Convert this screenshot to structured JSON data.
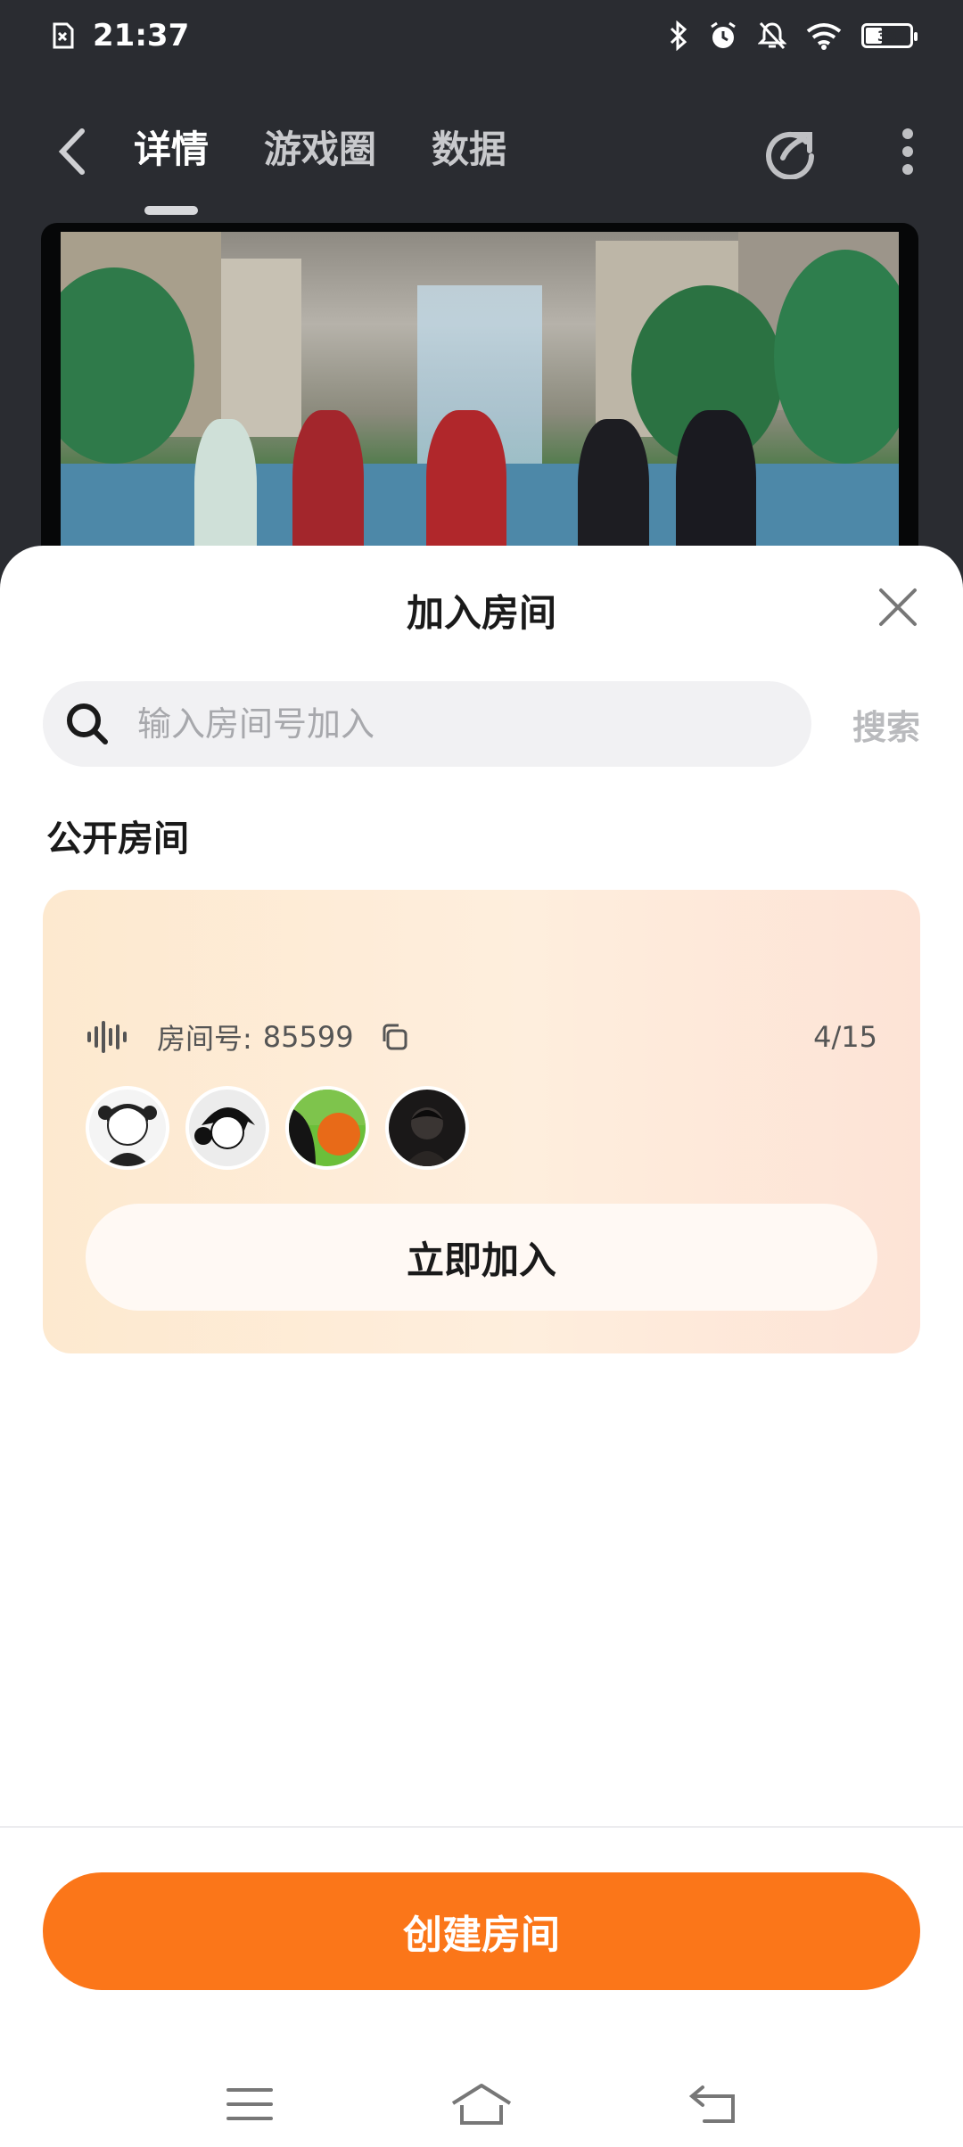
{
  "status_bar": {
    "time": "21:37",
    "battery": "35",
    "icons": [
      "sim-alert-icon",
      "bluetooth-icon",
      "alarm-icon",
      "mute-icon",
      "wifi-icon",
      "battery-icon"
    ]
  },
  "nav": {
    "tabs": [
      {
        "label": "详情",
        "active": true
      },
      {
        "label": "游戏圈",
        "active": false
      },
      {
        "label": "数据",
        "active": false
      }
    ],
    "icons": [
      "back-icon",
      "share-icon",
      "more-icon"
    ]
  },
  "sheet": {
    "title": "加入房间",
    "search": {
      "placeholder": "输入房间号加入",
      "value": "",
      "button_label": "搜索"
    },
    "section_title": "公开房间",
    "rooms": [
      {
        "label": "房间号:",
        "number": "85599",
        "count": "4/15",
        "join_label": "立即加入",
        "avatars": [
          "avatar-1",
          "avatar-2",
          "avatar-3",
          "avatar-4"
        ]
      }
    ],
    "create_label": "创建房间"
  },
  "colors": {
    "accent": "#fb7619",
    "card_gradient_start": "#fde9cf",
    "card_gradient_end": "#fde3d6",
    "search_bg": "#f1f1f3"
  },
  "system_nav": [
    "menu-icon",
    "home-icon",
    "back-nav-icon"
  ]
}
